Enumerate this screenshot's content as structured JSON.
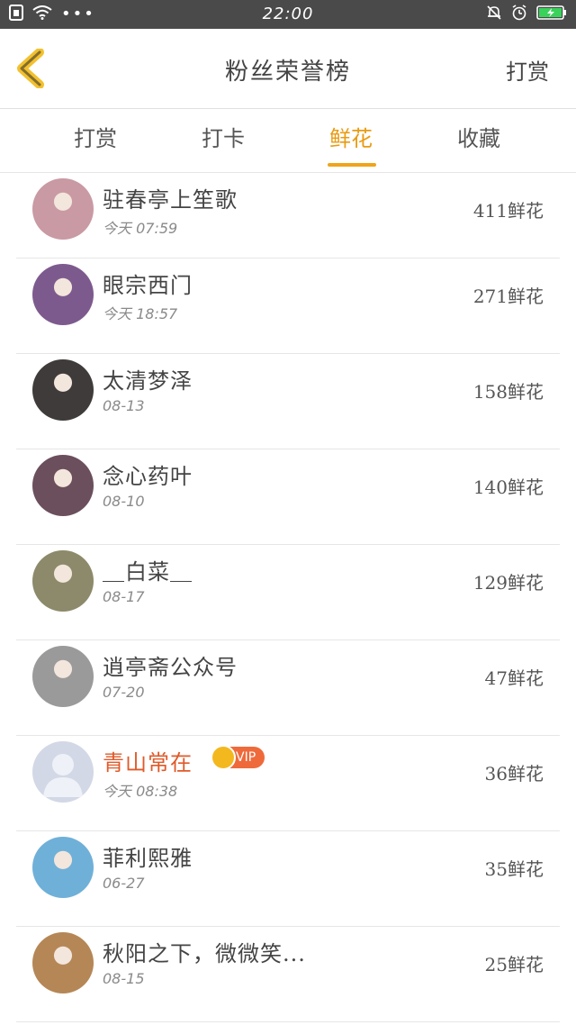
{
  "status_bar": {
    "time": "22:00",
    "icons": [
      "sim-icon",
      "wifi-icon",
      "more-dots-icon",
      "mute-bell-icon",
      "alarm-icon",
      "battery-charging-icon"
    ],
    "dots": "•••"
  },
  "nav": {
    "title": "粉丝荣誉榜",
    "right_action": "打赏",
    "back_icon": "chevron-left-icon",
    "accent_color": "#f0a41b"
  },
  "tabs": [
    {
      "label": "打赏",
      "active": false
    },
    {
      "label": "打卡",
      "active": false
    },
    {
      "label": "鲜花",
      "active": true
    },
    {
      "label": "收藏",
      "active": false
    }
  ],
  "list": [
    {
      "name": "驻春亭上笙歌",
      "time": "今天 07:59",
      "count": "411鲜花",
      "avatar_color": "#c99aa4"
    },
    {
      "name": "眼宗西门",
      "time": "今天 18:57",
      "count": "271鲜花",
      "avatar_color": "#7d5a8e"
    },
    {
      "name": "太清梦泽",
      "time": "08-13",
      "count": "158鲜花",
      "avatar_color": "#3f3b3a"
    },
    {
      "name": "念心药叶",
      "time": "08-10",
      "count": "140鲜花",
      "avatar_color": "#6b4f5c"
    },
    {
      "name": "＿白菜＿",
      "time": "08-17",
      "count": "129鲜花",
      "avatar_color": "#8c8a6a"
    },
    {
      "name": "逍亭斋公众号",
      "time": "07-20",
      "count": "47鲜花",
      "avatar_color": "#9a9a9a"
    },
    {
      "name": "青山常在",
      "time": "今天 08:38",
      "count": "36鲜花",
      "avatar_color": "#d3d8e6",
      "vip": "VIP"
    },
    {
      "name": "菲利熙雅",
      "time": "06-27",
      "count": "35鲜花",
      "avatar_color": "#6fb0d8"
    },
    {
      "name": "秋阳之下，微微笑...",
      "time": "08-15",
      "count": "25鲜花",
      "avatar_color": "#b58756"
    }
  ]
}
